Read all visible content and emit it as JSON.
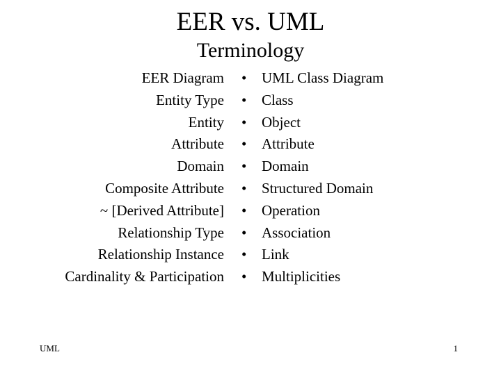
{
  "slide": {
    "title": "EER vs. UML",
    "subtitle": "Terminology",
    "eer_terms": [
      "EER Diagram",
      "Entity Type",
      "Entity",
      "Attribute",
      "Domain",
      "Composite Attribute",
      "~ [Derived Attribute]",
      "Relationship Type",
      "Relationship Instance",
      "Cardinality & Participation"
    ],
    "uml_terms": [
      "UML Class Diagram",
      "Class",
      "Object",
      "Attribute",
      "Domain",
      "Structured Domain",
      "Operation",
      "Association",
      "Link",
      "Multiplicities"
    ],
    "bullet_glyph": "•",
    "footer_left": "UML",
    "page_number": "1"
  }
}
